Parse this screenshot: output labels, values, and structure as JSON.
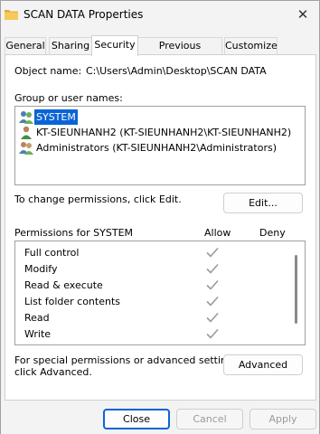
{
  "window": {
    "title": "SCAN DATA Properties",
    "close_glyph": "✕"
  },
  "tabs": [
    {
      "label": "General"
    },
    {
      "label": "Sharing"
    },
    {
      "label": "Security",
      "active": true
    },
    {
      "label": "Previous Versions"
    },
    {
      "label": "Customize"
    }
  ],
  "security": {
    "object_name_label": "Object name:",
    "object_name_value": "C:\\Users\\Admin\\Desktop\\SCAN DATA",
    "group_label": "Group or user names:",
    "groups": [
      {
        "name": "SYSTEM",
        "icon": "users-group-icon",
        "selected": true
      },
      {
        "name": "KT-SIEUNHANH2 (KT-SIEUNHANH2\\KT-SIEUNHANH2)",
        "icon": "user-icon"
      },
      {
        "name": "Administrators (KT-SIEUNHANH2\\Administrators)",
        "icon": "users-group-icon"
      }
    ],
    "change_hint": "To change permissions, click Edit.",
    "edit_button": "Edit...",
    "permissions_for_label": "Permissions for SYSTEM",
    "allow_header": "Allow",
    "deny_header": "Deny",
    "permissions": [
      {
        "name": "Full control",
        "allow": true,
        "deny": false
      },
      {
        "name": "Modify",
        "allow": true,
        "deny": false
      },
      {
        "name": "Read & execute",
        "allow": true,
        "deny": false
      },
      {
        "name": "List folder contents",
        "allow": true,
        "deny": false
      },
      {
        "name": "Read",
        "allow": true,
        "deny": false
      },
      {
        "name": "Write",
        "allow": true,
        "deny": false
      }
    ],
    "advanced_hint_line1": "For special permissions or advanced settings,",
    "advanced_hint_line2": "click Advanced.",
    "advanced_button": "Advanced"
  },
  "footer": {
    "close_button": "Close",
    "cancel_button": "Cancel",
    "apply_button": "Apply"
  },
  "colors": {
    "selection": "#0a64d6",
    "check_gray": "#9a9a9a",
    "folder": "#f2c14e"
  }
}
